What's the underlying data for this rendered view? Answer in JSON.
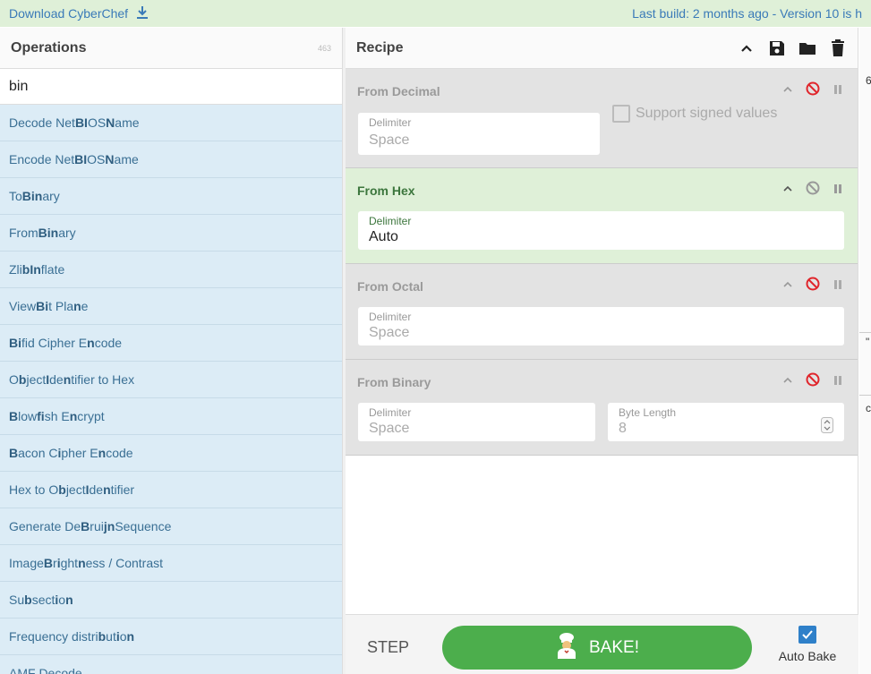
{
  "banner": {
    "download_label": "Download CyberChef",
    "last_build": "Last build: 2 months ago",
    "separator": "-",
    "version": "Version 10 is h"
  },
  "operations": {
    "title": "Operations",
    "count": "463",
    "search_value": "bin",
    "items": [
      {
        "parts": [
          {
            "t": "Decode Net"
          },
          {
            "t": "BI",
            "b": true
          },
          {
            "t": "OS "
          },
          {
            "t": "N",
            "b": true
          },
          {
            "t": "ame"
          }
        ]
      },
      {
        "parts": [
          {
            "t": "Encode Net"
          },
          {
            "t": "BI",
            "b": true
          },
          {
            "t": "OS "
          },
          {
            "t": "N",
            "b": true
          },
          {
            "t": "ame"
          }
        ]
      },
      {
        "parts": [
          {
            "t": "To "
          },
          {
            "t": "Bin",
            "b": true
          },
          {
            "t": "ary"
          }
        ]
      },
      {
        "parts": [
          {
            "t": "From "
          },
          {
            "t": "Bin",
            "b": true
          },
          {
            "t": "ary"
          }
        ]
      },
      {
        "parts": [
          {
            "t": "Zli"
          },
          {
            "t": "b",
            "b": true
          },
          {
            "t": " "
          },
          {
            "t": "In",
            "b": true
          },
          {
            "t": "flate"
          }
        ]
      },
      {
        "parts": [
          {
            "t": "View "
          },
          {
            "t": "Bi",
            "b": true
          },
          {
            "t": "t Pla"
          },
          {
            "t": "n",
            "b": true
          },
          {
            "t": "e"
          }
        ]
      },
      {
        "parts": [
          {
            "t": "Bi",
            "b": true
          },
          {
            "t": "fid Cipher E"
          },
          {
            "t": "n",
            "b": true
          },
          {
            "t": "code"
          }
        ]
      },
      {
        "parts": [
          {
            "t": "O"
          },
          {
            "t": "b",
            "b": true
          },
          {
            "t": "ject "
          },
          {
            "t": "I",
            "b": true
          },
          {
            "t": "de"
          },
          {
            "t": "n",
            "b": true
          },
          {
            "t": "tifier to Hex"
          }
        ]
      },
      {
        "parts": [
          {
            "t": "B",
            "b": true
          },
          {
            "t": "low"
          },
          {
            "t": "fi",
            "b": true
          },
          {
            "t": "sh E"
          },
          {
            "t": "n",
            "b": true
          },
          {
            "t": "crypt"
          }
        ]
      },
      {
        "parts": [
          {
            "t": "B",
            "b": true
          },
          {
            "t": "acon C"
          },
          {
            "t": "i",
            "b": true
          },
          {
            "t": "pher E"
          },
          {
            "t": "n",
            "b": true
          },
          {
            "t": "code"
          }
        ]
      },
      {
        "parts": [
          {
            "t": "Hex to O"
          },
          {
            "t": "b",
            "b": true
          },
          {
            "t": "ject "
          },
          {
            "t": "I",
            "b": true
          },
          {
            "t": "de"
          },
          {
            "t": "n",
            "b": true
          },
          {
            "t": "tifier"
          }
        ]
      },
      {
        "parts": [
          {
            "t": "Generate De "
          },
          {
            "t": "B",
            "b": true
          },
          {
            "t": "rui"
          },
          {
            "t": "jn",
            "b": true
          },
          {
            "t": " Sequence"
          }
        ]
      },
      {
        "parts": [
          {
            "t": "Image "
          },
          {
            "t": "B",
            "b": true
          },
          {
            "t": "r"
          },
          {
            "t": "i",
            "b": true
          },
          {
            "t": "ght"
          },
          {
            "t": "n",
            "b": true
          },
          {
            "t": "ess / Contrast"
          }
        ]
      },
      {
        "parts": [
          {
            "t": "Su"
          },
          {
            "t": "b",
            "b": true
          },
          {
            "t": "sect"
          },
          {
            "t": "i",
            "b": true
          },
          {
            "t": "o"
          },
          {
            "t": "n",
            "b": true
          }
        ]
      },
      {
        "parts": [
          {
            "t": "Frequency distri"
          },
          {
            "t": "b",
            "b": true
          },
          {
            "t": "ut"
          },
          {
            "t": "i",
            "b": true
          },
          {
            "t": "o"
          },
          {
            "t": "n",
            "b": true
          }
        ]
      },
      {
        "parts": [
          {
            "t": "AMF Decode"
          }
        ]
      }
    ]
  },
  "recipe": {
    "title": "Recipe",
    "ops": [
      {
        "name": "From Decimal",
        "state": "disabled",
        "fields": [
          {
            "label": "Delimiter",
            "value": "Space"
          }
        ],
        "checkbox": "Support signed values"
      },
      {
        "name": "From Hex",
        "state": "active",
        "fields": [
          {
            "label": "Delimiter",
            "value": "Auto"
          }
        ]
      },
      {
        "name": "From Octal",
        "state": "disabled",
        "fields": [
          {
            "label": "Delimiter",
            "value": "Space"
          }
        ]
      },
      {
        "name": "From Binary",
        "state": "disabled",
        "fields": [
          {
            "label": "Delimiter",
            "value": "Space"
          },
          {
            "label": "Byte Length",
            "value": "8"
          }
        ]
      }
    ]
  },
  "bake": {
    "step_label": "STEP",
    "bake_label": "BAKE!",
    "autobake_label": "Auto Bake"
  },
  "io": {
    "frag1": "6",
    "frag2": "\"",
    "frag3": "c"
  },
  "colors": {
    "banner_bg": "#dff0d8",
    "link": "#3a7ab8",
    "op_item_bg": "#dcecf6",
    "active_op_bg": "#dff0d8",
    "disabled_op_bg": "#e3e3e3",
    "disable_icon": "#e0262c",
    "bake_green": "#4cae4c",
    "checkbox_blue": "#2f80c9"
  }
}
